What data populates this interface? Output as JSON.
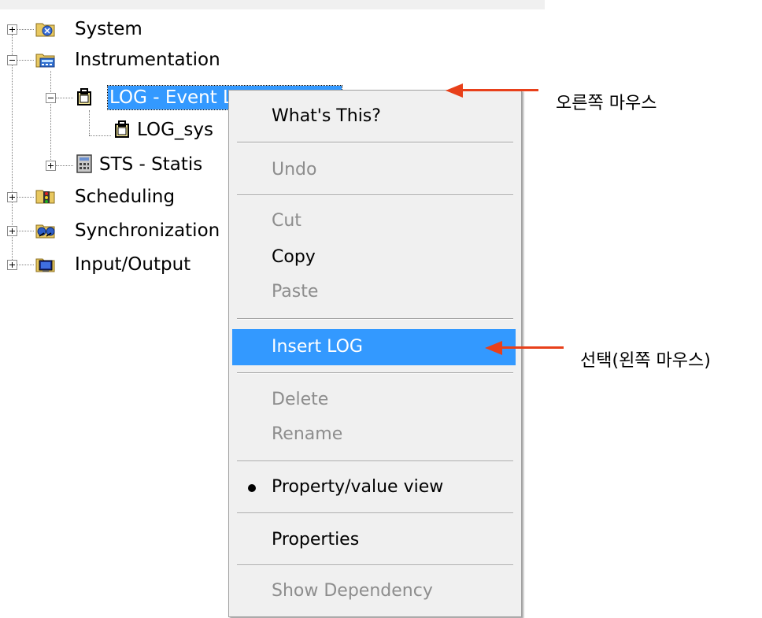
{
  "tree": {
    "system": "System",
    "instrumentation": "Instrumentation",
    "log_manager": "LOG - Event Log Manager",
    "log_sys": "LOG_sys",
    "sts": "STS - Statis",
    "scheduling": "Scheduling",
    "synchronization": "Synchronization",
    "input_output": "Input/Output"
  },
  "menu": {
    "whats_this": "What's This?",
    "undo": "Undo",
    "cut": "Cut",
    "copy": "Copy",
    "paste": "Paste",
    "insert_log": "Insert LOG",
    "delete": "Delete",
    "rename": "Rename",
    "property_value_view": "Property/value view",
    "properties": "Properties",
    "show_dependency": "Show Dependency"
  },
  "annotations": {
    "right_click": "오른쪽 마우스",
    "select_left_click": "선택(왼쪽 마우스)"
  },
  "colors": {
    "selection": "#3399ff",
    "arrow": "#e8401a",
    "menu_bg": "#f0f0f0"
  }
}
